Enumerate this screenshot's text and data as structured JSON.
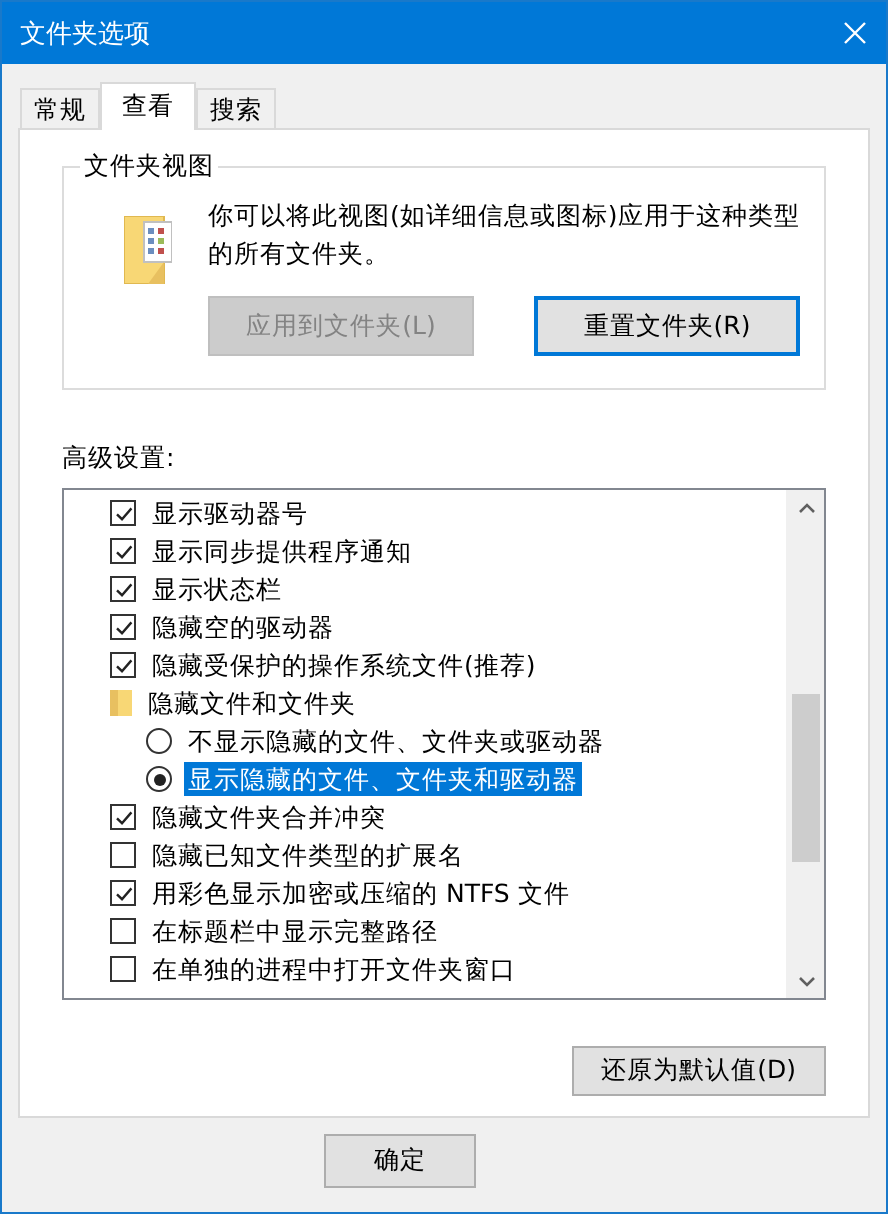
{
  "window": {
    "title": "文件夹选项"
  },
  "tabs": [
    {
      "label": "常规",
      "selected": false
    },
    {
      "label": "查看",
      "selected": true
    },
    {
      "label": "搜索",
      "selected": false
    }
  ],
  "folder_views": {
    "title": "文件夹视图",
    "description": "你可以将此视图(如详细信息或图标)应用于这种类型的所有文件夹。",
    "buttons": [
      {
        "label": "应用到文件夹(L)",
        "disabled": true,
        "focused": false
      },
      {
        "label": "重置文件夹(R)",
        "disabled": false,
        "focused": true
      }
    ]
  },
  "advanced": {
    "label": "高级设置:",
    "items": [
      {
        "kind": "checkbox",
        "label": "显示驱动器号",
        "checked": true
      },
      {
        "kind": "checkbox",
        "label": "显示同步提供程序通知",
        "checked": true
      },
      {
        "kind": "checkbox",
        "label": "显示状态栏",
        "checked": true
      },
      {
        "kind": "checkbox",
        "label": "隐藏空的驱动器",
        "checked": true
      },
      {
        "kind": "checkbox",
        "label": "隐藏受保护的操作系统文件(推荐)",
        "checked": true
      },
      {
        "kind": "folder",
        "label": "隐藏文件和文件夹",
        "children": [
          {
            "kind": "radio",
            "label": "不显示隐藏的文件、文件夹或驱动器",
            "selected": false
          },
          {
            "kind": "radio",
            "label": "显示隐藏的文件、文件夹和驱动器",
            "selected": true
          }
        ]
      },
      {
        "kind": "checkbox",
        "label": "隐藏文件夹合并冲突",
        "checked": true
      },
      {
        "kind": "checkbox",
        "label": "隐藏已知文件类型的扩展名",
        "checked": false
      },
      {
        "kind": "checkbox",
        "label": "用彩色显示加密或压缩的 NTFS 文件",
        "checked": true
      },
      {
        "kind": "checkbox",
        "label": "在标题栏中显示完整路径",
        "checked": false
      },
      {
        "kind": "checkbox",
        "label": "在单独的进程中打开文件夹窗口",
        "checked": false
      }
    ]
  },
  "restore_button": "还原为默认值(D)",
  "buttons": [
    "确定"
  ]
}
